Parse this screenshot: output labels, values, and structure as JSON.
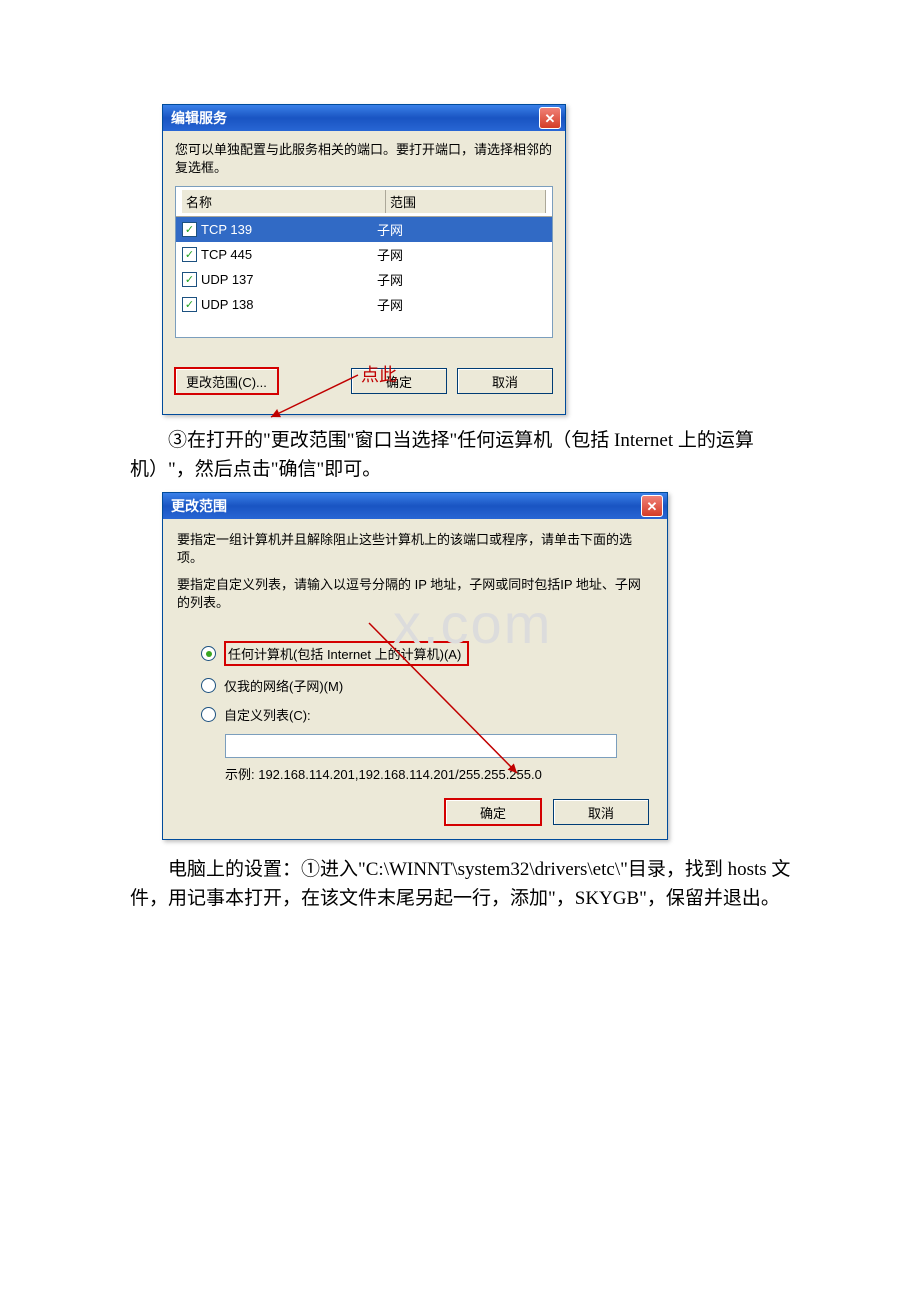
{
  "dlg1": {
    "title": "编辑服务",
    "desc": "您可以单独配置与此服务相关的端口。要打开端口，请选择相邻的复选框。",
    "col1": "名称",
    "col2": "范围",
    "rows": [
      {
        "name": "TCP 139",
        "scope": "子网",
        "sel": true
      },
      {
        "name": "TCP 445",
        "scope": "子网",
        "sel": false
      },
      {
        "name": "UDP 137",
        "scope": "子网",
        "sel": false
      },
      {
        "name": "UDP 138",
        "scope": "子网",
        "sel": false
      }
    ],
    "changeScope": "更改范围(C)...",
    "ok": "确定",
    "cancel": "取消",
    "anno": "点此"
  },
  "para1": "　　③在打开的\"更改范围\"窗口当选择\"任何运算机（包括 Internet 上的运算机）\"，然后点击\"确信\"即可。",
  "dlg2": {
    "title": "更改范围",
    "desc1": "要指定一组计算机并且解除阻止这些计算机上的该端口或程序，请单击下面的选项。",
    "desc2": "要指定自定义列表，请输入以逗号分隔的 IP 地址，子网或同时包括IP 地址、子网的列表。",
    "opt1": "任何计算机(包括 Internet 上的计算机)(A)",
    "opt2": "仅我的网络(子网)(M)",
    "opt3": "自定义列表(C):",
    "example": "示例: 192.168.114.201,192.168.114.201/255.255.255.0",
    "ok": "确定",
    "cancel": "取消"
  },
  "para2": "　　电脑上的设置：①进入\"C:\\WINNT\\system32\\drivers\\etc\\\"目录，找到 hosts 文件，用记事本打开，在该文件末尾另起一行，添加\"，SKYGB\"，保留并退出。",
  "watermark": "x.com"
}
